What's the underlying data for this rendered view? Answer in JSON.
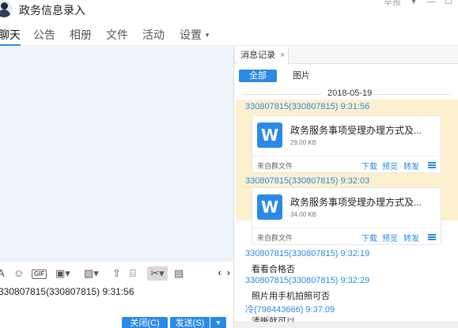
{
  "window": {
    "title": "政务信息录入",
    "report_label": "举报",
    "btn_menu": "▾",
    "btn_min": "—",
    "btn_max": "☐"
  },
  "nav": {
    "tabs": [
      {
        "label": "聊天",
        "active": true
      },
      {
        "label": "公告",
        "active": false
      },
      {
        "label": "相册",
        "active": false
      },
      {
        "label": "文件",
        "active": false
      },
      {
        "label": "活动",
        "active": false
      },
      {
        "label": "设置",
        "active": false,
        "dropdown": true
      }
    ]
  },
  "left": {
    "toolbar_icons": [
      "font-icon",
      "emoji-icon",
      "gif-icon",
      "gift-icon",
      "image-icon",
      "upload-icon",
      "calendar-icon",
      "scissors-icon",
      "clear-icon"
    ],
    "nav_arrows": "‹ ›",
    "input_text": "330807815(330807815)  9:31:56",
    "close_label": "关闭(C)",
    "send_label": "发送(S)",
    "send_menu": "▼"
  },
  "history": {
    "tab_label": "消息记录",
    "tab_close": "×",
    "filter_all": "全部",
    "filter_images": "图片",
    "date": "2018-05-19",
    "messages": [
      {
        "sender": "330807815(330807815) 9:31:56",
        "type": "file",
        "file_name": "政务服务事项受理办理方式及...",
        "file_size": "29.00 KB",
        "source": "来自群文件",
        "actions": [
          "下载",
          "预览",
          "转发"
        ],
        "highlighted": true
      },
      {
        "sender": "330807815(330807815) 9:32:03",
        "type": "file",
        "file_name": "政务服务事项受理办理方式及...",
        "file_size": "34.00 KB",
        "source": "来自群文件",
        "actions": [
          "下载",
          "预览",
          "转发"
        ],
        "highlighted": false
      },
      {
        "sender": "330807815(330807815) 9:32:19",
        "type": "text",
        "text": "看看合格否"
      },
      {
        "sender": "330807815(330807815) 9:32:29",
        "type": "text",
        "text": "照片用手机拍照可否"
      },
      {
        "sender": "冷(798443666) 9:37:09",
        "type": "text",
        "text": "清晰就可以"
      }
    ]
  },
  "colors": {
    "accent": "#2b8ae6",
    "highlight": "#fdf0cf",
    "chat_bg": "#eef3f9"
  }
}
